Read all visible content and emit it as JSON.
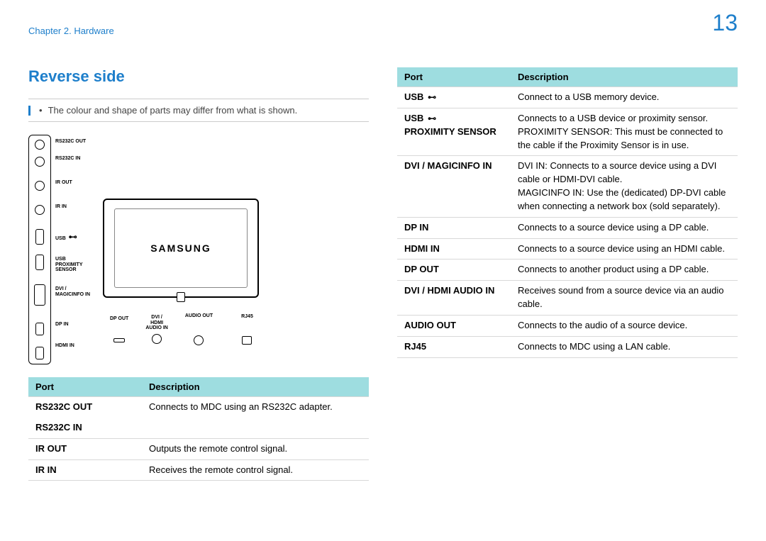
{
  "header": {
    "chapter": "Chapter 2. Hardware",
    "page_number": "13"
  },
  "section_title": "Reverse side",
  "note": "The colour and shape of parts may differ from what is shown.",
  "brand_logo": "SAMSUNG",
  "vertical_ports": {
    "rs232c_out": "RS232C OUT",
    "rs232c_in": "RS232C IN",
    "ir_out": "IR OUT",
    "ir_in": "IR IN",
    "usb": "USB",
    "usb_proximity": "USB\nPROXIMITY\nSENSOR",
    "dvi_magicinfo": "DVI /\nMAGICINFO IN",
    "dp_in": "DP IN",
    "hdmi_in": "HDMI IN"
  },
  "horizontal_ports": {
    "dp_out": "DP OUT",
    "dvi_hdmi_audio_in": "DVI /\nHDMI\nAUDIO IN",
    "audio_out": "AUDIO OUT",
    "rj45": "RJ45"
  },
  "table_headers": {
    "port": "Port",
    "description": "Description"
  },
  "table_left": [
    {
      "port": "RS232C OUT",
      "desc": "Connects to MDC using an RS232C adapter."
    },
    {
      "port": "RS232C IN",
      "desc": ""
    },
    {
      "port": "IR OUT",
      "desc": "Outputs the remote control signal."
    },
    {
      "port": "IR IN",
      "desc": "Receives the remote control signal."
    }
  ],
  "table_right": [
    {
      "port": "USB",
      "usb_icon": true,
      "desc": "Connect to a USB memory device."
    },
    {
      "port": "USB",
      "usb_icon": true,
      "port_line2": "PROXIMITY SENSOR",
      "desc": "Connects to a USB device or proximity sensor.\nPROXIMITY SENSOR: This must be connected to the cable if the Proximity Sensor is in use."
    },
    {
      "port": "DVI / MAGICINFO IN",
      "desc": "DVI IN: Connects to a source device using a DVI cable or HDMI-DVI cable.\nMAGICINFO IN: Use the (dedicated) DP-DVI cable when connecting a network box (sold separately)."
    },
    {
      "port": "DP IN",
      "desc": "Connects to a source device using a DP cable."
    },
    {
      "port": "HDMI IN",
      "desc": "Connects to a source device using an HDMI cable."
    },
    {
      "port": "DP OUT",
      "desc": "Connects to another product using a DP cable."
    },
    {
      "port": "DVI / HDMI AUDIO IN",
      "desc": "Receives sound from a source device via an audio cable."
    },
    {
      "port": "AUDIO OUT",
      "desc": "Connects to the audio of a source device."
    },
    {
      "port": "RJ45",
      "desc": "Connects to MDC using a LAN cable."
    }
  ]
}
